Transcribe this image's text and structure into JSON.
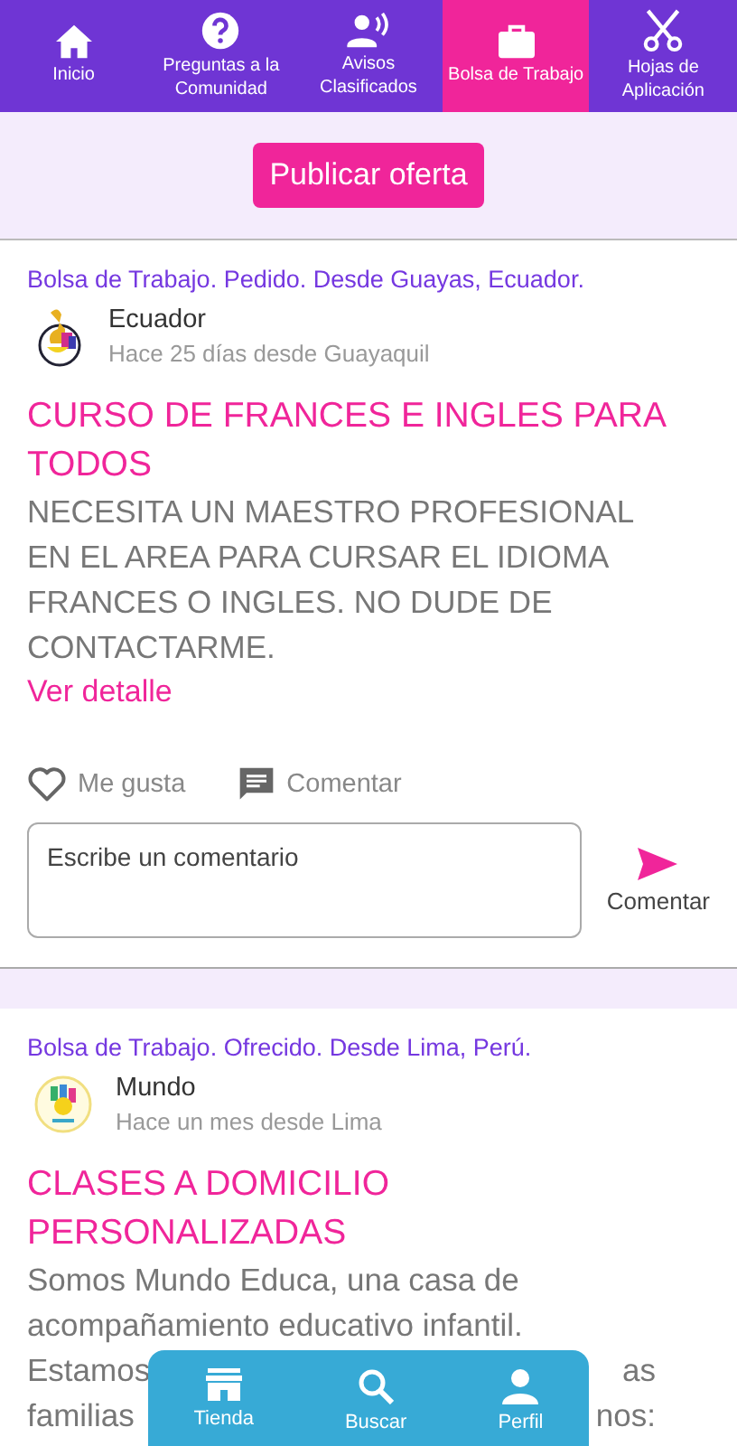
{
  "tabs": [
    {
      "label": "Inicio",
      "selected": false
    },
    {
      "label": "Preguntas a la Comunidad",
      "selected": false
    },
    {
      "label": "Avisos Clasificados",
      "selected": false
    },
    {
      "label": "Bolsa de Trabajo",
      "selected": true
    },
    {
      "label": "Hojas de Aplicación",
      "selected": false
    }
  ],
  "publish_button": "Publicar oferta",
  "posts": [
    {
      "category": "Bolsa de Trabajo. Pedido. Desde Guayas, Ecuador.",
      "author": "Ecuador",
      "time": "Hace 25 días desde Guayaquil",
      "title": "CURSO DE FRANCES E INGLES PARA TODOS",
      "body_lines": [
        {
          "text": "NECESITA UN MAESTRO PROFESIONAL EN EL AREA PARA CURSAR EL IDIOMA FRANCES O INGLES. NO DUDE DE CONTACTARME."
        }
      ],
      "detail_link": "Ver detalle",
      "like": "Me gusta",
      "comment": "Comentar",
      "comment_placeholder": "Escribe un comentario",
      "send": "Comentar"
    },
    {
      "category": "Bolsa de Trabajo. Ofrecido. Desde Lima, Perú.",
      "author": "Mundo",
      "time": "Hace un mes desde Lima",
      "title": "CLASES A DOMICILIO PERSONALIZADAS",
      "body_lines": [
        {
          "text": "Somos Mundo Educa, una casa de"
        },
        {
          "text": "acompañamiento educativo infantil."
        },
        {
          "left": "Estamos",
          "right": "as"
        },
        {
          "left": "familias",
          "right": "nos:"
        }
      ]
    }
  ],
  "bottom_nav": [
    {
      "label": "Tienda"
    },
    {
      "label": "Buscar"
    },
    {
      "label": "Perfil"
    }
  ]
}
